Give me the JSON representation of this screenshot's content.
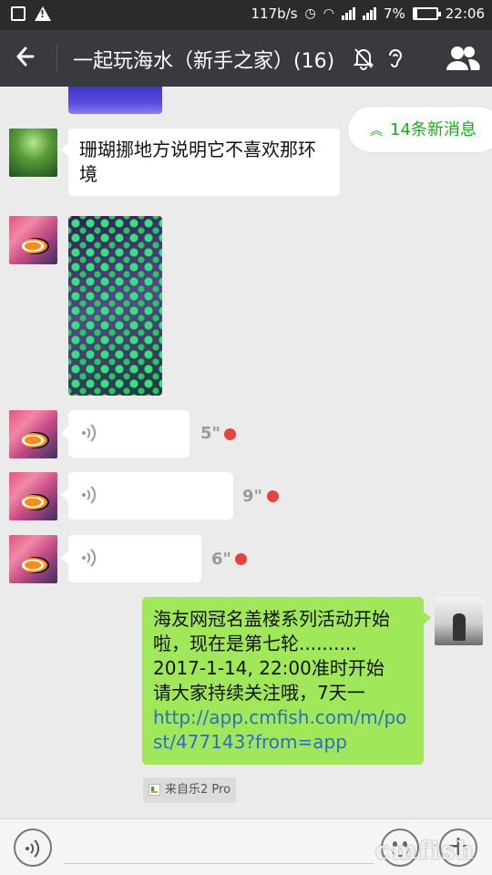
{
  "status_bar": {
    "speed": "117b/s",
    "battery": "7%",
    "time": "22:06"
  },
  "header": {
    "title": "一起玩海水（新手之家）(16)"
  },
  "new_messages": {
    "label": "14条新消息"
  },
  "messages": {
    "text1": "珊瑚挪地方说明它不喜欢那环境",
    "voice1_duration": "5\"",
    "voice2_duration": "9\"",
    "voice3_duration": "6\"",
    "sent_line1": "海友网冠名盖楼系列活动开始啦，现在是第七轮..........",
    "sent_line2": "2017-1-14, 22:00准时开始",
    "sent_line3": "请大家持续关注哦，7天一",
    "sent_link": "http://app.cmfish.com/m/post/477143?from=app",
    "source_label": "来自乐2 Pro"
  },
  "watermark": {
    "text": "cmfish"
  },
  "icons": {
    "back": "back-arrow-icon",
    "mute": "mute-bell-icon",
    "ear": "earpiece-icon",
    "group": "group-members-icon",
    "voice_input": "voice-input-icon",
    "emoji": "emoji-icon",
    "plus": "plus-icon"
  },
  "colors": {
    "titlebar": "#393a3f",
    "statusbar": "#2b2b2d",
    "sent_bubble": "#a0e75a",
    "accent_green": "#1aad19",
    "unread_dot": "#e64340",
    "link": "#2b6fc2"
  }
}
